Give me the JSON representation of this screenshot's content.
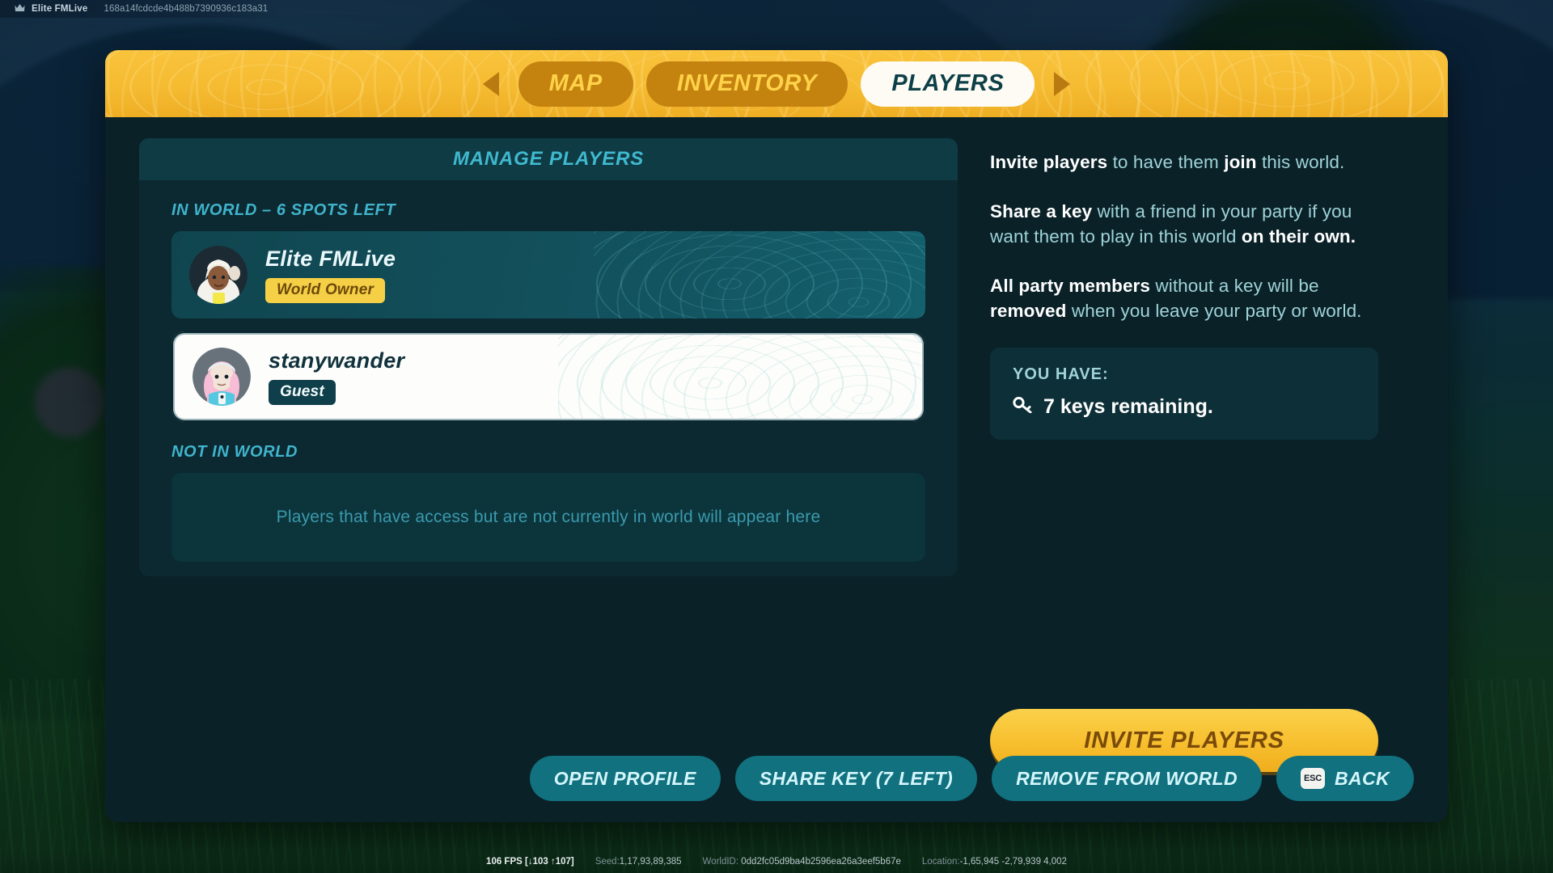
{
  "hud": {
    "crown_icon": "crown-icon",
    "world_name": "Elite FMLive",
    "world_hash": "168a14fcdcde4b488b7390936c183a31"
  },
  "tabs": {
    "prev_arrow_icon": "chevron-left-icon",
    "next_arrow_icon": "chevron-right-icon",
    "items": [
      {
        "label": "MAP",
        "active": false
      },
      {
        "label": "INVENTORY",
        "active": false
      },
      {
        "label": "PLAYERS",
        "active": true
      }
    ]
  },
  "panel": {
    "header_title": "MANAGE PLAYERS",
    "in_world_label": "IN WORLD – 6 SPOTS LEFT",
    "not_in_world_label": "NOT IN WORLD",
    "not_in_world_empty_text": "Players that have access but are not currently in world will appear here",
    "players": [
      {
        "name": "Elite FMLive",
        "role": "World Owner",
        "selected": false
      },
      {
        "name": "stanywander",
        "role": "Guest",
        "selected": true
      }
    ]
  },
  "info": {
    "paragraph_1": {
      "b1": "Invite players",
      "t1": " to have them ",
      "b2": "join",
      "t2": " this world."
    },
    "paragraph_2": {
      "b1": "Share a key",
      "t1": " with a friend in your party if you want them to play in this world ",
      "b2": "on their own.",
      "t2": ""
    },
    "paragraph_3": {
      "b1": "All party members",
      "t1": " without a key will be ",
      "b2": "removed",
      "t2": " when you leave your party or world."
    }
  },
  "keys_box": {
    "label": "YOU HAVE:",
    "key_icon": "key-icon",
    "value": "7 keys remaining."
  },
  "invite_button": {
    "label": "INVITE PLAYERS"
  },
  "footer": {
    "buttons": [
      {
        "label": "OPEN PROFILE",
        "key_hint": ""
      },
      {
        "label": "SHARE KEY (7 LEFT)",
        "key_hint": ""
      },
      {
        "label": "REMOVE FROM WORLD",
        "key_hint": ""
      },
      {
        "label": "BACK",
        "key_hint": "ESC"
      }
    ]
  },
  "status_bar": {
    "fps": "106 FPS [↓103 ↑107]",
    "seed_key": "Seed:",
    "seed_val": "1,17,93,89,385",
    "worldid_key": "WorldID:",
    "worldid_val": "0dd2fc05d9ba4b2596ea26a3eef5b67e",
    "location_key": "Location:",
    "location_val": "-1,65,945  -2,79,939  4,002"
  }
}
